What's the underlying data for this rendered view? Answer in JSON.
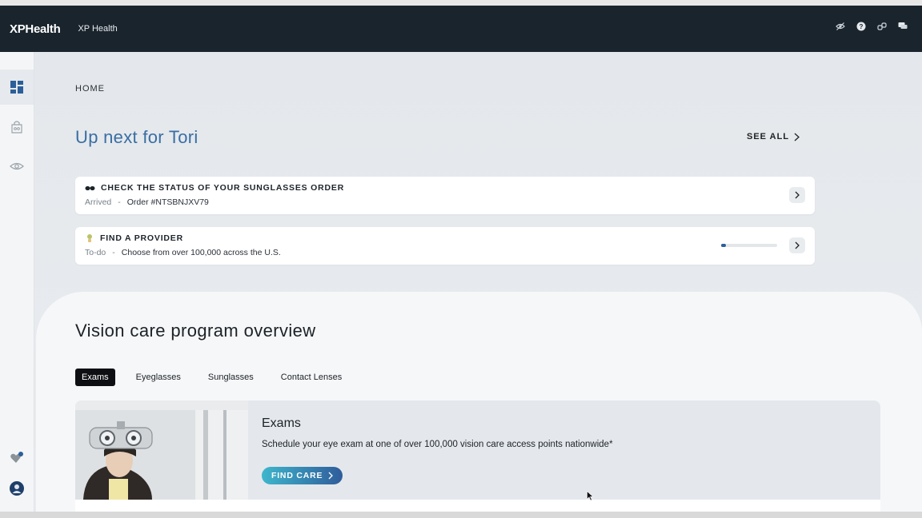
{
  "header": {
    "brand": "XPHealth",
    "app_name": "XP Health",
    "icons": [
      "eye-off-icon",
      "help-icon",
      "link-icon",
      "chat-icon"
    ]
  },
  "sidebar": {
    "items": [
      {
        "name": "dashboard-icon",
        "active": true
      },
      {
        "name": "bag-icon",
        "active": false
      },
      {
        "name": "eye-icon",
        "active": false
      }
    ],
    "bottom_items": [
      {
        "name": "heart-badge-icon"
      },
      {
        "name": "avatar"
      }
    ]
  },
  "main": {
    "breadcrumb": "HOME",
    "up_next_title": "Up next for Tori",
    "see_all": "SEE ALL",
    "cards": [
      {
        "icon": "sunglasses-icon",
        "title": "CHECK THE STATUS OF YOUR SUNGLASSES ORDER",
        "status": "Arrived",
        "separator": "-",
        "detail": "Order #NTSBNJXV79"
      },
      {
        "icon": "provider-icon",
        "title": "FIND A PROVIDER",
        "status": "To-do",
        "separator": "-",
        "detail": "Choose from over 100,000 across the U.S.",
        "progress": 0.08
      }
    ],
    "overview": {
      "title": "Vision care program overview",
      "tabs": [
        "Exams",
        "Eyeglasses",
        "Sunglasses",
        "Contact Lenses"
      ],
      "active_tab": "Exams",
      "feature": {
        "title": "Exams",
        "description": "Schedule your eye exam at one of over 100,000 vision care access points nationwide*",
        "button": "FIND CARE"
      }
    }
  },
  "colors": {
    "topbar": "#1a242d",
    "accent_title": "#3a6ea3",
    "button_gradient_start": "#3fb6cc",
    "button_gradient_end": "#2f5c9b"
  }
}
